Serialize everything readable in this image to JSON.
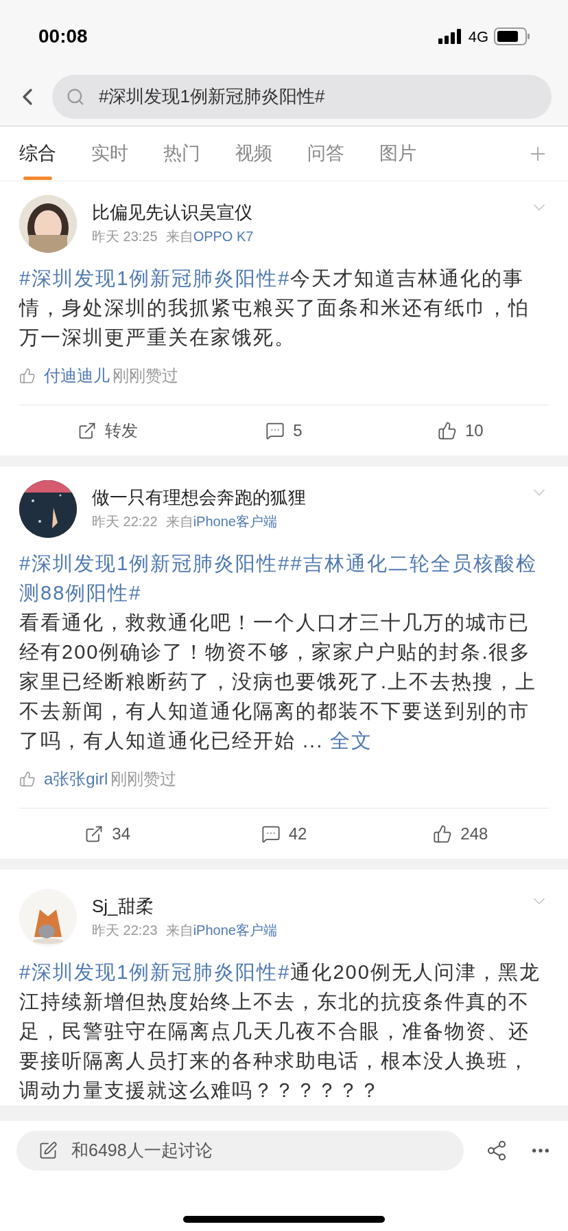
{
  "status_bar": {
    "time": "00:08",
    "network": "4G"
  },
  "search": {
    "query": "#深圳发现1例新冠肺炎阳性#"
  },
  "tabs": [
    {
      "label": "综合",
      "selected": true
    },
    {
      "label": "实时",
      "selected": false
    },
    {
      "label": "热门",
      "selected": false
    },
    {
      "label": "视频",
      "selected": false
    },
    {
      "label": "问答",
      "selected": false
    },
    {
      "label": "图片",
      "selected": false
    }
  ],
  "posts": [
    {
      "author": "比偏见先认识吴宣仪",
      "day": "昨天",
      "time": "23:25",
      "source_prefix": "来自",
      "source": "OPPO K7",
      "paragraphs": [
        [
          {
            "kind": "topic",
            "text": "#深圳发现1例新冠肺炎阳性#"
          },
          {
            "kind": "text",
            "text": "今天才知道吉林通化的事情，身处深圳的我抓紧屯粮买了面条和米还有纸巾，怕万一深圳更严重关在家饿死。"
          }
        ]
      ],
      "liked_by": {
        "name": "付迪迪儿",
        "suffix": "刚刚赞过"
      },
      "actions": {
        "repost": "转发",
        "comments": "5",
        "likes": "10"
      }
    },
    {
      "author": "做一只有理想会奔跑的狐狸",
      "day": "昨天",
      "time": "22:22",
      "source_prefix": "来自",
      "source": "iPhone客户端",
      "paragraphs": [
        [
          {
            "kind": "topic",
            "text": "#深圳发现1例新冠肺炎阳性#"
          },
          {
            "kind": "topic",
            "text": "#吉林通化二轮全员核酸检测88例阳性#"
          }
        ],
        [
          {
            "kind": "text",
            "text": "看看通化，救救通化吧！一个人口才三十几万的城市已经有200例确诊了！物资不够，家家户户贴的封条.很多家里已经断粮断药了，没病也要饿死了.上不去热搜，上不去新闻，有人知道通化隔离的都装不下要送到别的市了吗，有人知道通化已经开始 ... "
          },
          {
            "kind": "more",
            "text": "全文"
          }
        ]
      ],
      "liked_by": {
        "name": "a张张girl",
        "suffix": "刚刚赞过"
      },
      "actions": {
        "repost": "34",
        "comments": "42",
        "likes": "248"
      }
    },
    {
      "author": "Sj_甜柔",
      "day": "昨天",
      "time": "22:23",
      "source_prefix": "来自",
      "source": "iPhone客户端",
      "paragraphs": [
        [
          {
            "kind": "topic",
            "text": "#深圳发现1例新冠肺炎阳性#"
          },
          {
            "kind": "text",
            "text": "通化200例无人问津，黑龙江持续新增但热度始终上不去，东北的抗疫条件真的不足，民警驻守在隔离点几天几夜不合眼，准备物资、还要接听隔离人员打来的各种求助电话，根本没人换班，调动力量支援就这么难吗？？？？？？"
          }
        ]
      ]
    }
  ],
  "bottom_bar": {
    "placeholder": "和6498人一起讨论"
  }
}
